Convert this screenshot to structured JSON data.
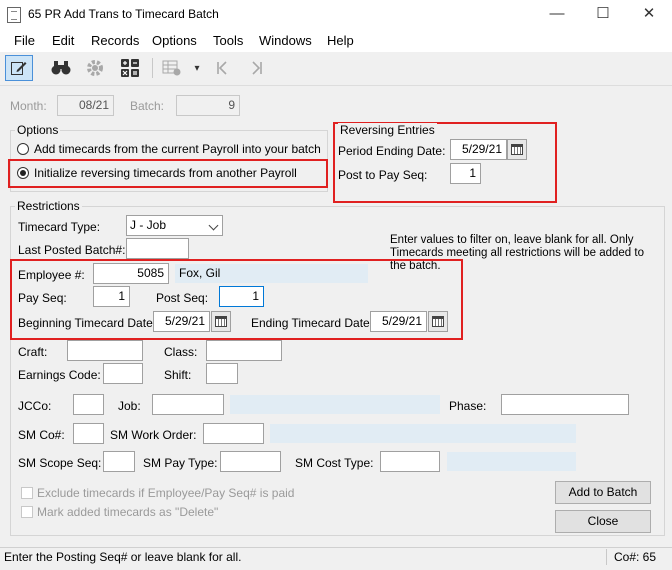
{
  "window": {
    "title": "65 PR Add Trans to Timecard Batch",
    "minimize": "—",
    "maximize": "☐",
    "close": "✕"
  },
  "menu": [
    "File",
    "Edit",
    "Records",
    "Options",
    "Tools",
    "Windows",
    "Help"
  ],
  "toolbar": [
    "edit-icon",
    "binoculars-icon",
    "gear-icon",
    "calculator-icon",
    "grid-settings-icon",
    "dropdown-arrow-icon",
    "first-record-icon",
    "last-record-icon"
  ],
  "header": {
    "month_label": "Month:",
    "month_value": "08/21",
    "batch_label": "Batch:",
    "batch_value": "9"
  },
  "options": {
    "title": "Options",
    "radio_add": "Add timecards from the current Payroll into your batch",
    "radio_init": "Initialize reversing timecards from another Payroll"
  },
  "reversing": {
    "title": "Reversing Entries",
    "period_label": "Period Ending Date:",
    "period_value": "5/29/21",
    "post_label": "Post to Pay Seq:",
    "post_value": "1"
  },
  "restrictions": {
    "title": "Restrictions",
    "timecard_type_label": "Timecard Type:",
    "timecard_type_value": "J - Job",
    "last_posted_label": "Last Posted Batch#:",
    "last_posted_value": "",
    "info_text": "Enter values to filter on, leave blank for all. Only Timecards meeting all restrictions will be added to the batch.",
    "employee_label": "Employee #:",
    "employee_value": "5085",
    "employee_name": "Fox, Gil",
    "payseq_label": "Pay Seq:",
    "payseq_value": "1",
    "postseq_label": "Post Seq:",
    "postseq_value": "1",
    "begin_label": "Beginning Timecard Date:",
    "begin_value": "5/29/21",
    "end_label": "Ending Timecard Date:",
    "end_value": "5/29/21",
    "craft_label": "Craft:",
    "class_label": "Class:",
    "earnings_label": "Earnings Code:",
    "shift_label": "Shift:",
    "jcco_label": "JCCo:",
    "job_label": "Job:",
    "phase_label": "Phase:",
    "smco_label": "SM Co#:",
    "sm_work_order_label": "SM Work Order:",
    "sm_scope_label": "SM Scope Seq:",
    "sm_pay_type_label": "SM Pay Type:",
    "sm_cost_type_label": "SM Cost Type:"
  },
  "checkboxes": {
    "exclude": "Exclude timecards if Employee/Pay Seq# is paid",
    "mark_delete": "Mark added timecards as \"Delete\""
  },
  "buttons": {
    "add": "Add to Batch",
    "close": "Close"
  },
  "status": {
    "message": "Enter the Posting Seq# or leave blank for all.",
    "company": "Co#: 65"
  }
}
